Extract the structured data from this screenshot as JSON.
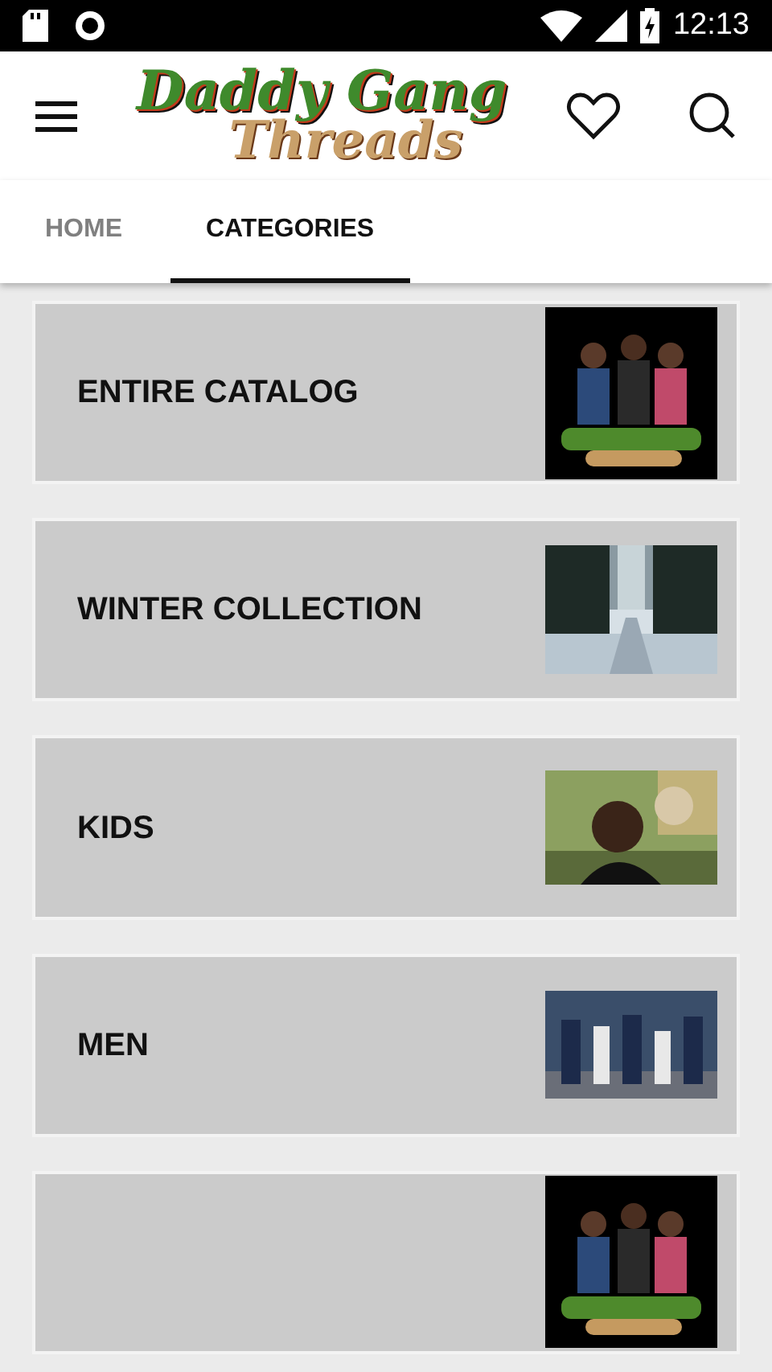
{
  "status_bar": {
    "time": "12:13"
  },
  "header": {
    "logo_lines": [
      "Daddy Gang",
      "Threads"
    ]
  },
  "tabs": [
    {
      "label": "HOME",
      "selected": false
    },
    {
      "label": "CATEGORIES",
      "selected": true
    }
  ],
  "categories": [
    {
      "title": "ENTIRE CATALOG",
      "picture": {
        "kind": "picture"
      }
    },
    {
      "title": "WINTER COLLECTION",
      "picture": {
        "kind": "picture"
      }
    },
    {
      "title": "KIDS",
      "picture": {
        "kind": "picture"
      }
    },
    {
      "title": "MEN",
      "picture": {
        "kind": "picture"
      }
    },
    {
      "picture": {
        "kind": "picture"
      }
    }
  ]
}
